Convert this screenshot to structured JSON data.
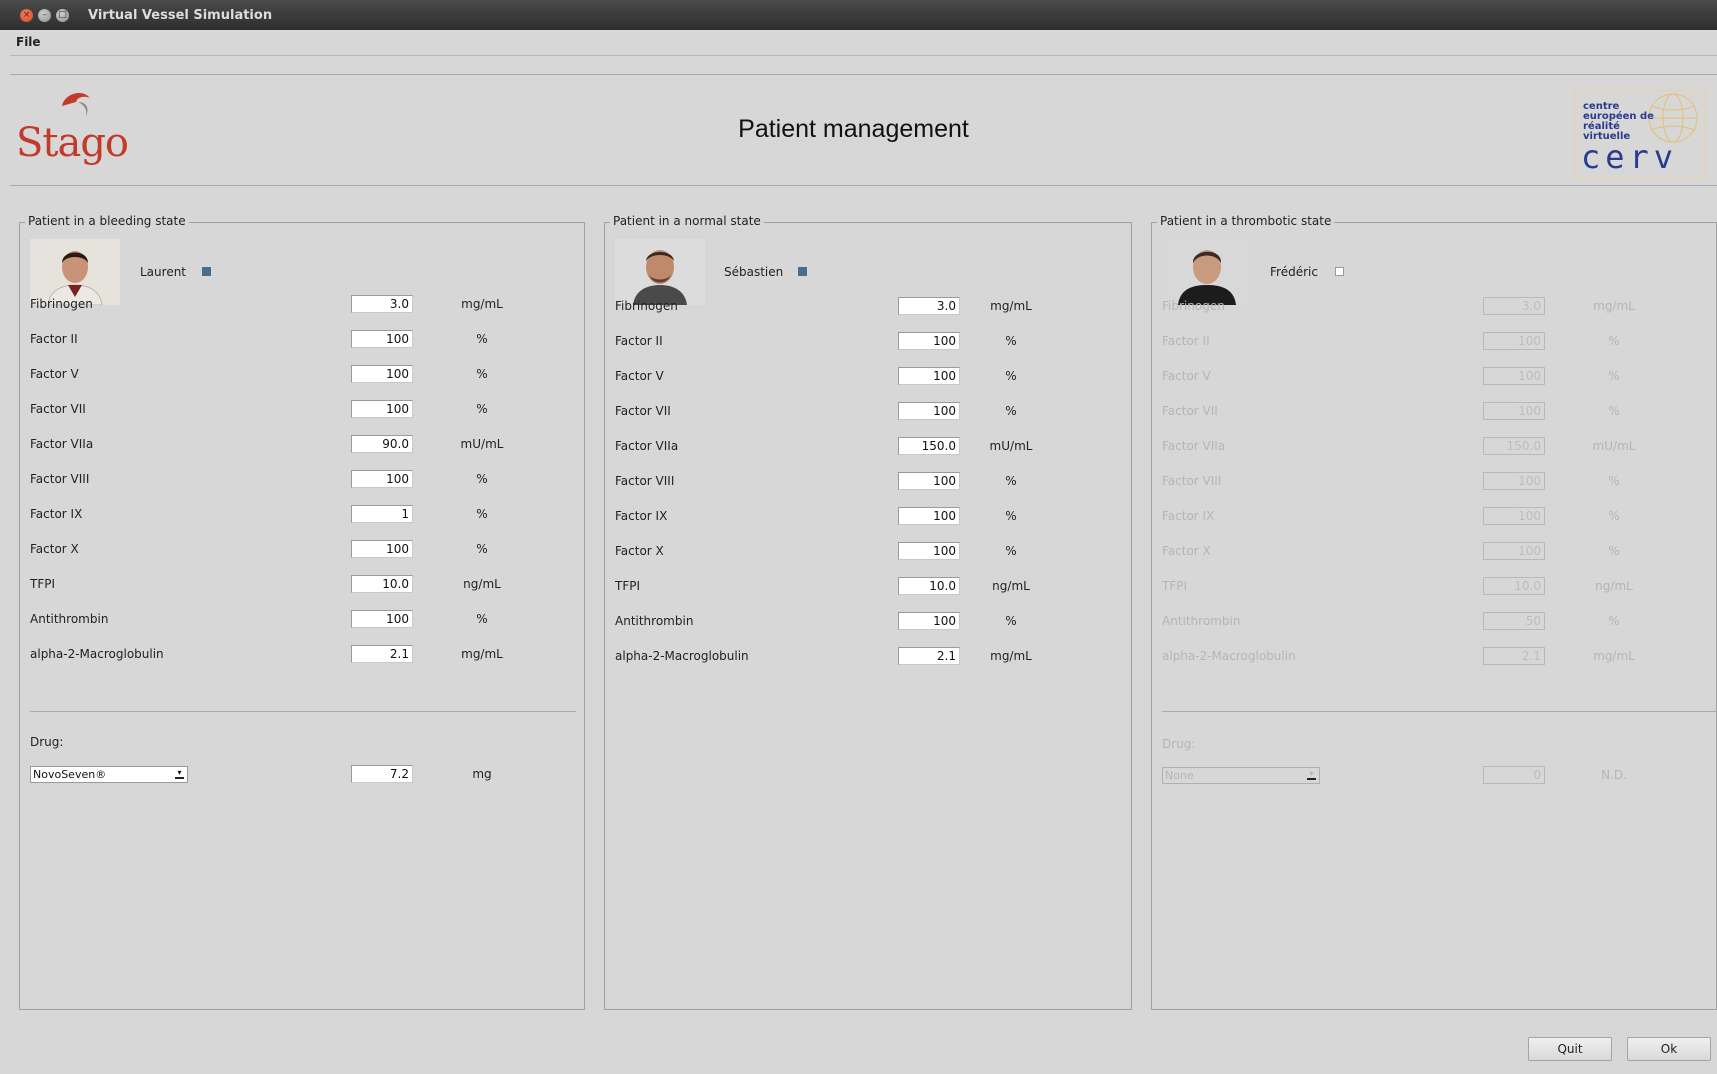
{
  "window": {
    "title": "Virtual Vessel Simulation"
  },
  "menu": {
    "file": "File"
  },
  "header": {
    "title": "Patient management",
    "stago_logo": "Stago",
    "cerv_logo": {
      "line1": "centre",
      "line2": "européen de",
      "line3": "réalité",
      "line4": "virtuelle",
      "big": "cerv"
    }
  },
  "panels": [
    {
      "legend": "Patient in a bleeding state",
      "name": "Laurent",
      "checked": true,
      "enabled": true,
      "rows": [
        {
          "label": "Fibrinogen",
          "value": "3.0",
          "unit": "mg/mL"
        },
        {
          "label": "Factor II",
          "value": "100",
          "unit": "%"
        },
        {
          "label": "Factor V",
          "value": "100",
          "unit": "%"
        },
        {
          "label": "Factor VII",
          "value": "100",
          "unit": "%"
        },
        {
          "label": "Factor VIIa",
          "value": "90.0",
          "unit": "mU/mL"
        },
        {
          "label": "Factor VIII",
          "value": "100",
          "unit": "%"
        },
        {
          "label": "Factor IX",
          "value": "1",
          "unit": "%"
        },
        {
          "label": "Factor X",
          "value": "100",
          "unit": "%"
        },
        {
          "label": "TFPI",
          "value": "10.0",
          "unit": "ng/mL"
        },
        {
          "label": "Antithrombin",
          "value": "100",
          "unit": "%"
        },
        {
          "label": "alpha-2-Macroglobulin",
          "value": "2.1",
          "unit": "mg/mL"
        }
      ],
      "drug": {
        "label": "Drug:",
        "selected": "NovoSeven®",
        "value": "7.2",
        "unit": "mg"
      }
    },
    {
      "legend": "Patient in a normal state",
      "name": "Sébastien",
      "checked": true,
      "enabled": true,
      "rows": [
        {
          "label": "Fibrinogen",
          "value": "3.0",
          "unit": "mg/mL"
        },
        {
          "label": "Factor II",
          "value": "100",
          "unit": "%"
        },
        {
          "label": "Factor V",
          "value": "100",
          "unit": "%"
        },
        {
          "label": "Factor VII",
          "value": "100",
          "unit": "%"
        },
        {
          "label": "Factor VIIa",
          "value": "150.0",
          "unit": "mU/mL"
        },
        {
          "label": "Factor VIII",
          "value": "100",
          "unit": "%"
        },
        {
          "label": "Factor IX",
          "value": "100",
          "unit": "%"
        },
        {
          "label": "Factor X",
          "value": "100",
          "unit": "%"
        },
        {
          "label": "TFPI",
          "value": "10.0",
          "unit": "ng/mL"
        },
        {
          "label": "Antithrombin",
          "value": "100",
          "unit": "%"
        },
        {
          "label": "alpha-2-Macroglobulin",
          "value": "2.1",
          "unit": "mg/mL"
        }
      ]
    },
    {
      "legend": "Patient in a thrombotic state",
      "name": "Frédéric",
      "checked": false,
      "enabled": false,
      "rows": [
        {
          "label": "Fibrinogen",
          "value": "3.0",
          "unit": "mg/mL"
        },
        {
          "label": "Factor II",
          "value": "100",
          "unit": "%"
        },
        {
          "label": "Factor V",
          "value": "100",
          "unit": "%"
        },
        {
          "label": "Factor VII",
          "value": "100",
          "unit": "%"
        },
        {
          "label": "Factor VIIa",
          "value": "150.0",
          "unit": "mU/mL"
        },
        {
          "label": "Factor VIII",
          "value": "100",
          "unit": "%"
        },
        {
          "label": "Factor IX",
          "value": "100",
          "unit": "%"
        },
        {
          "label": "Factor X",
          "value": "100",
          "unit": "%"
        },
        {
          "label": "TFPI",
          "value": "10.0",
          "unit": "ng/mL"
        },
        {
          "label": "Antithrombin",
          "value": "50",
          "unit": "%"
        },
        {
          "label": "alpha-2-Macroglobulin",
          "value": "2.1",
          "unit": "mg/mL"
        }
      ],
      "drug": {
        "label": "Drug:",
        "selected": "None",
        "value": "0",
        "unit": "N.D."
      }
    }
  ],
  "buttons": {
    "quit": "Quit",
    "ok": "Ok"
  },
  "colors": {
    "background": "#d7d7d7",
    "titlebar": "#3a3a3a",
    "stago_red": "#c23a2a",
    "cerv_blue": "#2a3a8e",
    "checked": "#4a6d8c"
  }
}
